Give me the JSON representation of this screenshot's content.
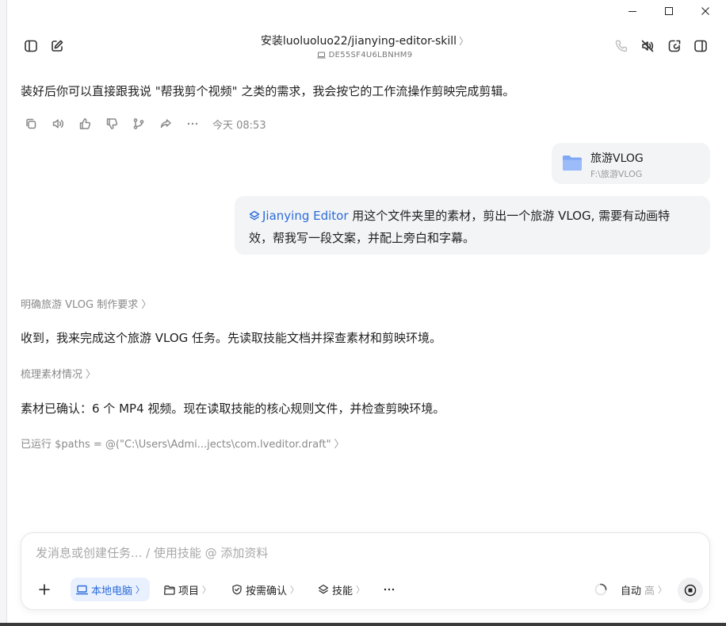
{
  "window": {
    "controls": [
      "minimize-icon",
      "maximize-icon",
      "close-icon"
    ]
  },
  "header": {
    "title": "安装luoluoluo22/jianying-editor-skill",
    "device_id": "DE55SF4U6LBNHM9",
    "left_icons": [
      "sidebar-toggle-icon",
      "new-chat-icon"
    ],
    "right_icons": [
      "phone-icon",
      "volume-mute-icon",
      "refresh-window-icon",
      "panel-toggle-icon"
    ]
  },
  "conversation": {
    "assistant_reply": "装好后你可以直接跟我说 \"帮我剪个视频\" 之类的需求，我会按它的工作流操作剪映完成剪辑。",
    "reply_time": "今天 08:53",
    "reply_actions": [
      "copy-icon",
      "read-aloud-icon",
      "thumbs-up-icon",
      "thumbs-down-icon",
      "branch-icon",
      "share-icon",
      "more-icon"
    ],
    "attachment": {
      "name": "旅游VLOG",
      "path": "F:\\旅游VLOG"
    },
    "user_message": {
      "skill": "Jianying Editor",
      "line1": " 用这个文件夹里的素材，剪出一个旅游 VLOG, 需要有动画特",
      "line2": "效，帮我写一段文案，并配上旁白和字幕。"
    },
    "step1_label": "明确旅游 VLOG 制作要求",
    "step1_text": "收到，我来完成这个旅游 VLOG 任务。先读取技能文档并探查素材和剪映环境。",
    "step2_label": "梳理素材情况",
    "step2_text": "素材已确认：6 个 MP4 视频。现在读取技能的核心规则文件，并检查剪映环境。",
    "step3_label": "已运行 $paths = @(\"C:\\Users\\Admi...jects\\com.lveditor.draft\""
  },
  "composer": {
    "placeholder": "发消息或创建任务... / 使用技能 @ 添加资料",
    "add_icon": "plus-icon",
    "local_label": "本地电脑",
    "project_label": "项目",
    "confirm_label": "按需确认",
    "skills_label": "技能",
    "more_icon": "more-icon",
    "auto_label": "自动",
    "auto_level": "高",
    "stop_icon": "stop-icon"
  },
  "colors": {
    "accent": "#2a6bd9",
    "bubble": "#f3f4f6",
    "folder": "#7fa8f5"
  }
}
